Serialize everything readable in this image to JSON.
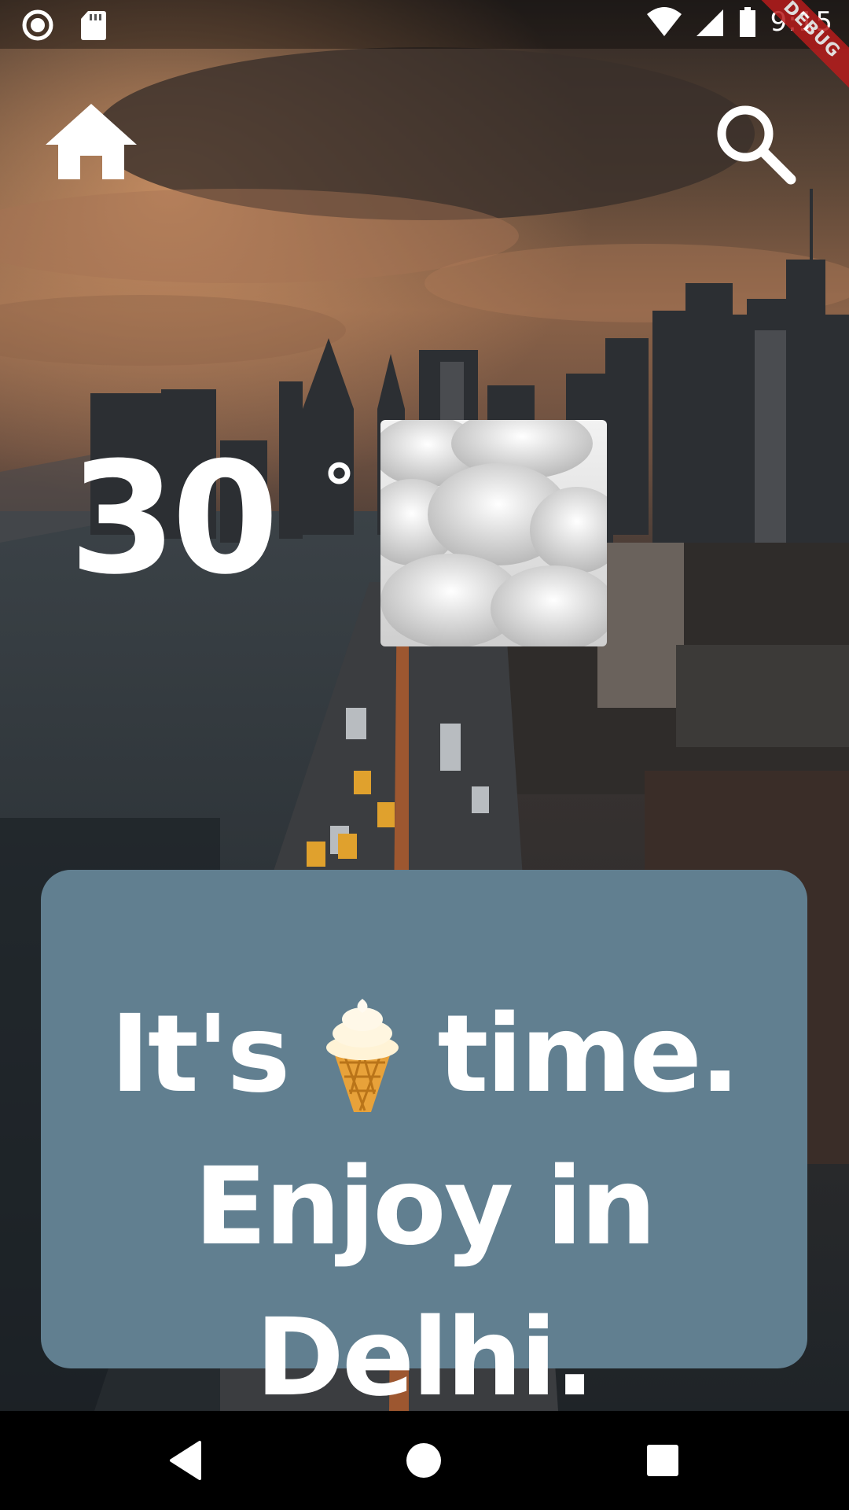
{
  "status_bar": {
    "time": "9:15",
    "debug_label": "DEBUG",
    "icons": [
      "record-icon",
      "sd-card-icon",
      "wifi-icon",
      "signal-icon",
      "battery-icon"
    ]
  },
  "header": {
    "home_icon": "home-icon",
    "search_icon": "search-icon"
  },
  "weather": {
    "temperature": "30",
    "degree_symbol": "°",
    "condition_icon": "cloud-icon"
  },
  "message": {
    "word_its": "It's",
    "emoji_icon": "ice-cream-icon",
    "word_time": "time.",
    "line2": "Enjoy in",
    "line3": "Delhi."
  },
  "nav_bar": {
    "back_icon": "back-triangle-icon",
    "home_icon": "home-circle-icon",
    "recents_icon": "recents-square-icon"
  },
  "colors": {
    "card": "#617f90",
    "text": "#ffffff",
    "debug": "#b71c1c",
    "nav": "#000000"
  }
}
